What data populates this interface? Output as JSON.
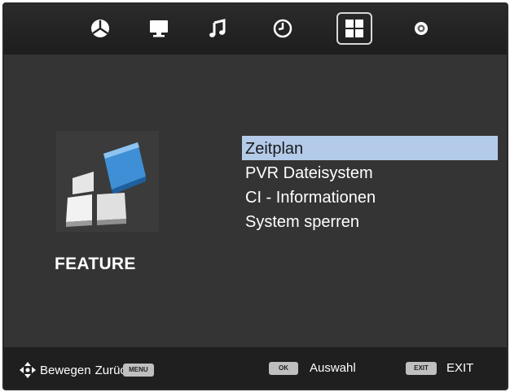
{
  "tabs": [
    {
      "icon": "satellite-dish-icon",
      "selected": false
    },
    {
      "icon": "monitor-icon",
      "selected": false
    },
    {
      "icon": "music-note-icon",
      "selected": false
    },
    {
      "icon": "clock-icon",
      "selected": false
    },
    {
      "icon": "feature-grid-icon",
      "selected": true
    },
    {
      "icon": "gear-icon",
      "selected": false
    }
  ],
  "section": {
    "title": "FEATURE",
    "icon": "feature-cube-icon"
  },
  "menu": {
    "items": [
      {
        "label": "Zeitplan",
        "selected": true
      },
      {
        "label": "PVR Dateisystem",
        "selected": false
      },
      {
        "label": "CI - Informationen",
        "selected": false
      },
      {
        "label": "System sperren",
        "selected": false
      }
    ]
  },
  "footer": {
    "move_label": "Bewegen",
    "back_label": "Zurüc",
    "menu_key": "MENU",
    "ok_key": "OK",
    "select_label": "Auswahl",
    "exit_key": "EXIT",
    "exit_label": "EXIT"
  },
  "colors": {
    "background": "#343434",
    "topbar": "#222222",
    "footer": "#1f1f1f",
    "selected_item": "#b3cbe9",
    "accent_blue": "#3f8fd6"
  }
}
